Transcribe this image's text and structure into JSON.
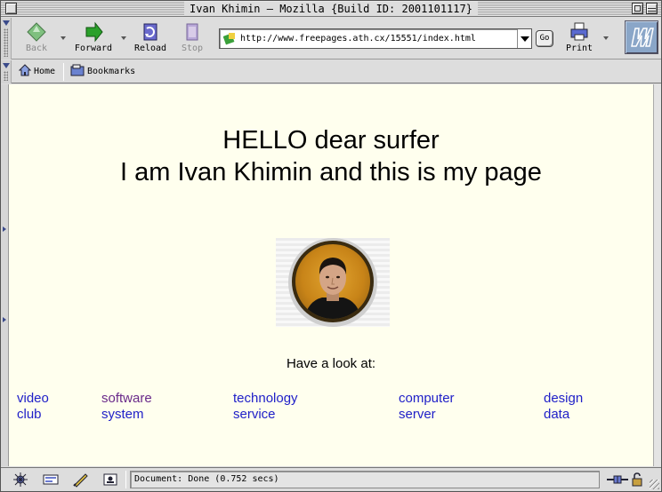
{
  "window": {
    "title": "Ivan Khimin – Mozilla {Build ID: 2001101117}"
  },
  "navbar": {
    "back_label": "Back",
    "forward_label": "Forward",
    "reload_label": "Reload",
    "stop_label": "Stop",
    "url": "http://www.freepages.ath.cx/15551/index.html",
    "go_label": "Go",
    "print_label": "Print"
  },
  "personal_toolbar": {
    "home_label": "Home",
    "bookmarks_label": "Bookmarks"
  },
  "page": {
    "heading_line1": "HELLO dear surfer",
    "heading_line2": "I am Ivan Khimin and this is my page",
    "look_text": "Have a look at:",
    "links": [
      {
        "line1": "video",
        "line2": "club",
        "visited": false
      },
      {
        "line1": "software",
        "line2": "system",
        "visited": true
      },
      {
        "line1": "technology",
        "line2": "service",
        "visited": false
      },
      {
        "line1": "computer",
        "line2": "server",
        "visited": false
      },
      {
        "line1": "design",
        "line2": "data",
        "visited": false
      }
    ]
  },
  "status": {
    "text": "Document: Done (0.752 secs)"
  },
  "colors": {
    "page_bg": "#ffffee",
    "link": "#2020c8",
    "visited_link": "#6a2a8a"
  }
}
